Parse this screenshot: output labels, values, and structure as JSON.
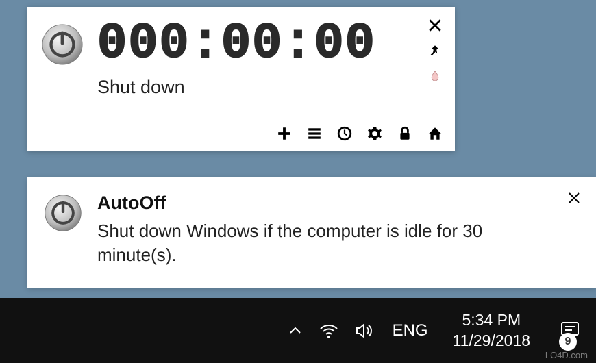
{
  "timer": {
    "digits": "000:00:00",
    "action": "Shut down"
  },
  "notification": {
    "title": "AutoOff",
    "body": "Shut down Windows if the computer is idle for 30 minute(s)."
  },
  "taskbar": {
    "lang": "ENG",
    "time": "5:34 PM",
    "date": "11/29/2018"
  },
  "watermark": "LO4D.com"
}
